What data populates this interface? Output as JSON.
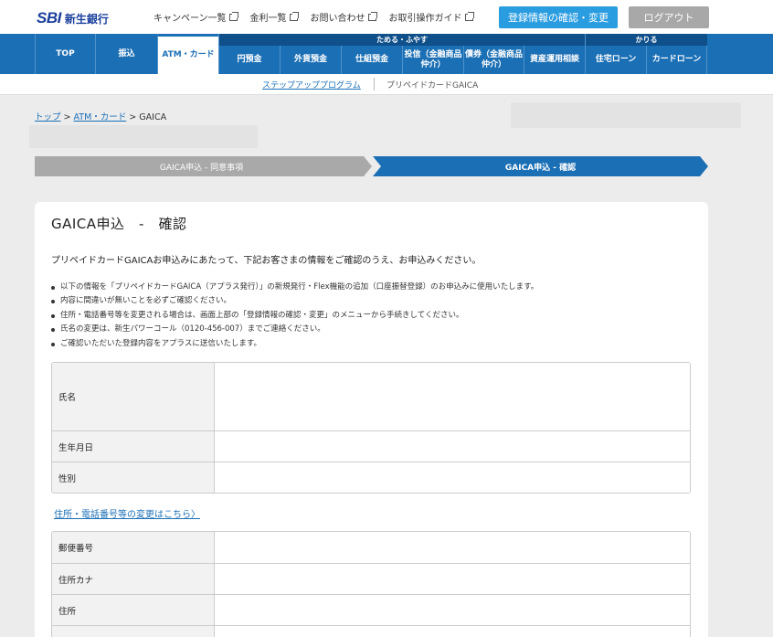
{
  "header": {
    "logo_sbi": "SBI",
    "logo_bank": "新生銀行",
    "links": [
      "キャンペーン一覧",
      "金利一覧",
      "お問い合わせ",
      "お取引操作ガイド"
    ],
    "register_button": "登録情報の確認・変更",
    "logout_button": "ログアウト"
  },
  "nav": {
    "groups": {
      "save": "ためる・ふやす",
      "borrow": "かりる"
    },
    "items": [
      "TOP",
      "振込",
      "ATM・カード",
      "円預金",
      "外貨預金",
      "仕組預金",
      "投信（金融商品仲介）",
      "債券（金融商品仲介）",
      "資産運用相談",
      "住宅ローン",
      "カードローン"
    ],
    "active_index": 2
  },
  "subnav": {
    "link": "ステップアッププログラム",
    "current": "プリペイドカードGAICA"
  },
  "breadcrumb": {
    "top": "トップ",
    "sep1": " > ",
    "atm": "ATM・カード",
    "sep2": " > ",
    "current": "GAICA"
  },
  "steps": [
    {
      "label": "GAICA申込 - 同意事項",
      "active": false
    },
    {
      "label": "GAICA申込 - 確認",
      "active": true
    }
  ],
  "content": {
    "title": "GAICA申込　-　確認",
    "intro": "プリペイドカードGAICAお申込みにあたって、下記お客さまの情報をご確認のうえ、お申込みください。",
    "notes": [
      "以下の情報を「プリペイドカードGAICA（アプラス発行）」の新規発行・Flex機能の追加（口座振替登録）のお申込みに使用いたします。",
      "内容に間違いが無いことを必ずご確認ください。",
      "住所・電話番号等を変更される場合は、画面上部の「登録情報の確認・変更」のメニューから手続きしてください。",
      "氏名の変更は、新生パワーコール（0120-456-007）までご連絡ください。",
      "ご確認いただいた登録内容をアプラスに送信いたします。"
    ],
    "table1": [
      {
        "label": "氏名",
        "value": ""
      },
      {
        "label": "生年月日",
        "value": ""
      },
      {
        "label": "性別",
        "value": ""
      }
    ],
    "change_link": "住所・電話番号等の変更はこちら〉",
    "table2": [
      {
        "label": "郵便番号",
        "value": ""
      },
      {
        "label": "住所カナ",
        "value": ""
      },
      {
        "label": "住所",
        "value": ""
      }
    ]
  },
  "colors": {
    "nav_blue": "#1b6fb5",
    "step_active": "#1b6fb5",
    "step_inactive": "#a9a9a9",
    "register_button": "#2a9ce0",
    "logout_button": "#a8a8a8"
  }
}
